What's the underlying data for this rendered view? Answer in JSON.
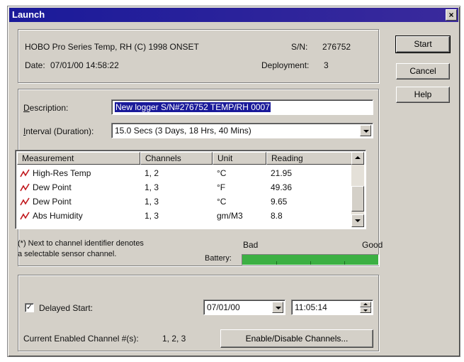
{
  "window": {
    "title": "Launch",
    "close_glyph": "×"
  },
  "logger": {
    "model": "HOBO Pro Series Temp, RH (C) 1998 ONSET",
    "sn_label": "S/N:",
    "sn_value": "276752",
    "date_label": "Date:",
    "date_value": "07/01/00  14:58:22",
    "deployment_label": "Deployment:",
    "deployment_value": "3"
  },
  "buttons": {
    "start": "Start",
    "cancel": "Cancel",
    "help": "Help",
    "enable_disable": "Enable/Disable Channels..."
  },
  "description": {
    "label": "Description:",
    "value": "New logger S/N#276752 TEMP/RH  0007"
  },
  "interval": {
    "label": "Interval (Duration):",
    "value": "15.0 Secs  (3 Days, 18 Hrs, 40 Mins)"
  },
  "measurements": {
    "columns": [
      "Measurement",
      "Channels",
      "Unit",
      "Reading"
    ],
    "rows": [
      {
        "name": "High-Res Temp",
        "channels": "1, 2",
        "unit": "°C",
        "reading": "21.95",
        "icon": "sensor-graph-icon"
      },
      {
        "name": "Dew Point",
        "channels": "1, 3",
        "unit": "°F",
        "reading": "49.36",
        "icon": "sensor-graph-icon"
      },
      {
        "name": "Dew Point",
        "channels": "1, 3",
        "unit": "°C",
        "reading": "9.65",
        "icon": "sensor-graph-icon"
      },
      {
        "name": "Abs Humidity",
        "channels": "1, 3",
        "unit": "gm/M3",
        "reading": "8.8",
        "icon": "sensor-graph-icon"
      }
    ]
  },
  "note": {
    "line1": "(*) Next to channel identifier denotes",
    "line2": "a selectable sensor channel."
  },
  "battery": {
    "label": "Battery:",
    "bad_label": "Bad",
    "good_label": "Good",
    "level": 1.0,
    "color": "#3cb043"
  },
  "delayed_start": {
    "label": "Delayed Start:",
    "checked": true,
    "check_glyph": "✓",
    "date_value": "07/01/00",
    "time_value": "11:05:14"
  },
  "enabled_channels": {
    "label": "Current Enabled Channel #(s):",
    "value": "1, 2, 3"
  }
}
